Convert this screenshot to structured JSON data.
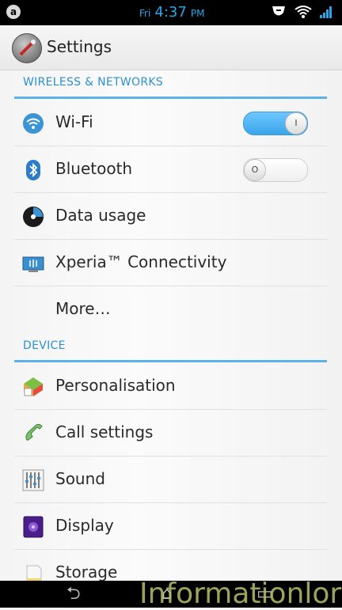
{
  "status_bar": {
    "day": "Fri",
    "time": "4:37",
    "ampm": "PM"
  },
  "action_bar": {
    "title": "Settings"
  },
  "sections": [
    {
      "header": "WIRELESS & NETWORKS",
      "items": [
        {
          "label": "Wi-Fi",
          "icon": "wifi-icon",
          "toggle": "on"
        },
        {
          "label": "Bluetooth",
          "icon": "bluetooth-icon",
          "toggle": "off"
        },
        {
          "label": "Data usage",
          "icon": "data-usage-icon"
        },
        {
          "label": "Xperia™ Connectivity",
          "icon": "connectivity-icon"
        },
        {
          "label": "More…",
          "icon": ""
        }
      ]
    },
    {
      "header": "DEVICE",
      "items": [
        {
          "label": "Personalisation",
          "icon": "personalisation-icon"
        },
        {
          "label": "Call settings",
          "icon": "phone-icon"
        },
        {
          "label": "Sound",
          "icon": "equalizer-icon"
        },
        {
          "label": "Display",
          "icon": "display-icon"
        },
        {
          "label": "Storage",
          "icon": "storage-icon"
        }
      ]
    }
  ],
  "watermark": "Informationlord",
  "colors": {
    "accent": "#2e8fd1",
    "toggle_on": "#3aa5ea"
  }
}
